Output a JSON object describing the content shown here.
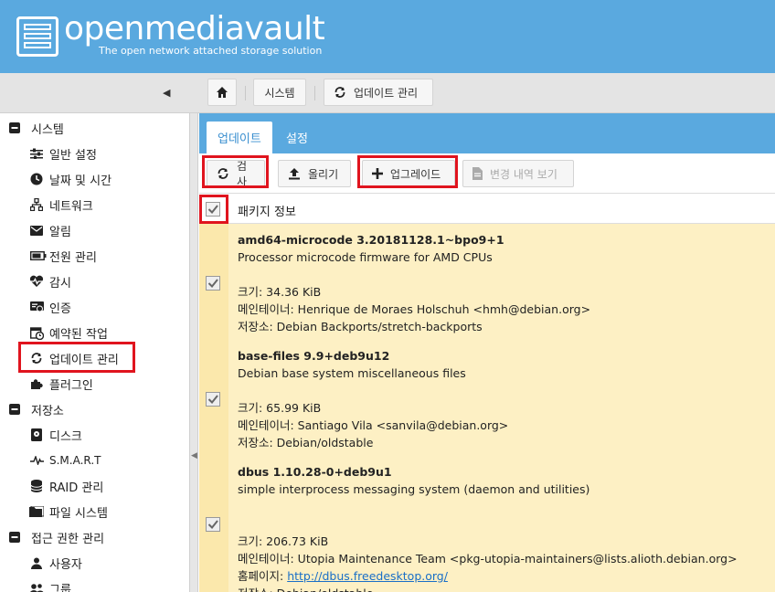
{
  "header": {
    "title": "openmediavault",
    "subtitle": "The open network attached storage solution"
  },
  "breadcrumb": {
    "home_icon": "home-icon",
    "system_label": "시스템",
    "update_label": "업데이트 관리"
  },
  "sidebar": {
    "groups": "그룹",
    "system_label": "시스템",
    "storage_label": "저장소",
    "access_label": "접근 권한 관리",
    "general": "일반 설정",
    "datetime": "날짜 및 시간",
    "network": "네트워크",
    "notification": "알림",
    "power": "전원 관리",
    "monitoring": "감시",
    "certificates": "인증",
    "scheduled": "예약된 작업",
    "update": "업데이트 관리",
    "plugins": "플러그인",
    "disks": "디스크",
    "smart": "S.M.A.R.T",
    "raid": "RAID 관리",
    "filesystems": "파일 시스템",
    "users": "사용자"
  },
  "tabs": {
    "updates": "업데이트",
    "settings": "설정"
  },
  "toolbar": {
    "check": "검사",
    "upload": "올리기",
    "upgrade": "업그레이드",
    "changelog": "변경 내역 보기"
  },
  "grid": {
    "header": "패키지 정보",
    "packages": [
      {
        "name": "amd64-microcode 3.20181128.1~bpo9+1",
        "description": "Processor microcode firmware for AMD CPUs",
        "size": "크기: 34.36 KiB",
        "maintainer": "메인테이너: Henrique de Moraes Holschuh <hmh@debian.org>",
        "repository": "저장소: Debian Backports/stretch-backports",
        "checked": true
      },
      {
        "name": "base-files 9.9+deb9u12",
        "description": "Debian base system miscellaneous files",
        "size": "크기: 65.99 KiB",
        "maintainer": "메인테이너: Santiago Vila <sanvila@debian.org>",
        "repository": "저장소: Debian/oldstable",
        "checked": true
      },
      {
        "name": "dbus 1.10.28-0+deb9u1",
        "description": "simple interprocess messaging system (daemon and utilities)",
        "size": "크기: 206.73 KiB",
        "maintainer": "메인테이너: Utopia Maintenance Team <pkg-utopia-maintainers@lists.alioth.debian.org>",
        "homepage_label": "홈페이지: ",
        "homepage_url": "http://dbus.freedesktop.org/",
        "repository": "저장소: Debian/oldstable",
        "checked": true
      }
    ]
  },
  "colors": {
    "header_bg": "#5aa9df",
    "row_bg": "#fdf0c4",
    "highlight": "#e0141e",
    "link": "#1a6fc7"
  }
}
